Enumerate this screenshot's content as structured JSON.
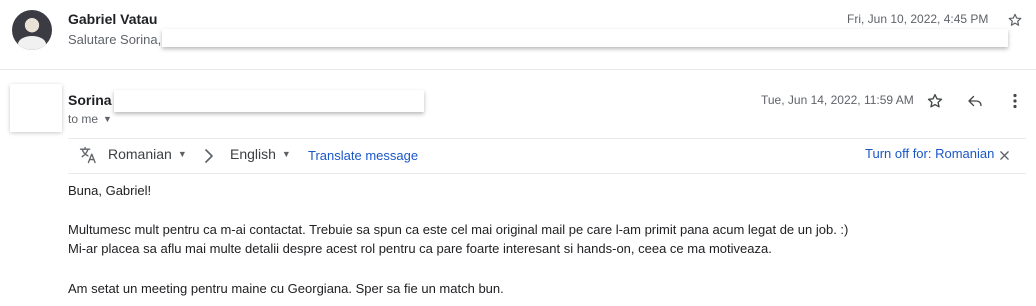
{
  "message1": {
    "sender": "Gabriel Vatau",
    "snippet": "Salutare Sorina,",
    "date": "Fri, Jun 10, 2022, 4:45 PM"
  },
  "message2": {
    "sender": "Sorina",
    "recipient": "to me",
    "date": "Tue, Jun 14, 2022, 11:59 AM"
  },
  "translate": {
    "source_lang": "Romanian",
    "target_lang": "English",
    "translate_link": "Translate message",
    "turn_off": "Turn off for: Romanian"
  },
  "body": {
    "greeting": "Buna, Gabriel!",
    "line1": "Multumesc mult pentru ca m-ai contactat. Trebuie sa spun ca este cel mai original mail pe care l-am primit pana acum legat de un job. :)",
    "line2": "Mi-ar placea sa aflu mai multe detalii despre acest rol pentru ca pare foarte interesant si hands-on, ceea ce ma motiveaza.",
    "line3": "Am setat un meeting pentru maine cu Georgiana. Sper sa fie un match bun."
  },
  "icons": [
    "star-icon",
    "reply-icon",
    "more-vert-icon",
    "translate-icon",
    "chevron-right-icon",
    "close-icon",
    "dropdown-caret-icon"
  ]
}
